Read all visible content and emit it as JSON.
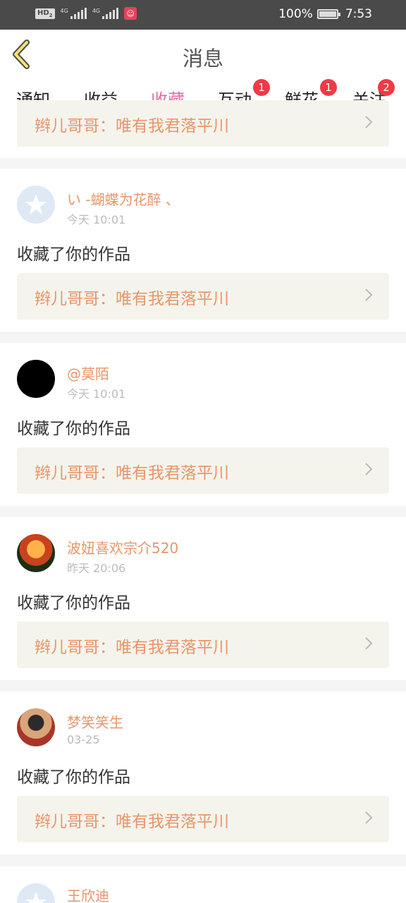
{
  "status_bar": {
    "hd": "HD",
    "hd_sub": "2",
    "net1": "4G",
    "net2": "4G",
    "battery": "100%",
    "time": "7:53"
  },
  "header": {
    "title": "消息"
  },
  "tabs": [
    {
      "label": "通知",
      "badge": ""
    },
    {
      "label": "收益",
      "badge": ""
    },
    {
      "label": "收藏",
      "badge": ""
    },
    {
      "label": "互动",
      "badge": "1"
    },
    {
      "label": "鲜花",
      "badge": "1"
    },
    {
      "label": "关注",
      "badge": "2"
    }
  ],
  "active_tab": "收藏",
  "top_partial_work": "辫儿哥哥：唯有我君落平川",
  "items": [
    {
      "name": "い -蝴蝶为花醉 、",
      "time": "今天 10:01",
      "action": "收藏了你的作品",
      "work": "辫儿哥哥：唯有我君落平川"
    },
    {
      "name": "@莫陌",
      "time": "今天 10:01",
      "action": "收藏了你的作品",
      "work": "辫儿哥哥：唯有我君落平川"
    },
    {
      "name": "波妞喜欢宗介520",
      "time": "昨天 20:06",
      "action": "收藏了你的作品",
      "work": "辫儿哥哥：唯有我君落平川"
    },
    {
      "name": "梦笑笑生",
      "time": "03-25",
      "action": "收藏了你的作品",
      "work": "辫儿哥哥：唯有我君落平川"
    },
    {
      "name": "王欣迪",
      "time": "",
      "action": "",
      "work": ""
    }
  ],
  "colors": {
    "accent": "#e36aa5",
    "name": "#e9956a",
    "badge": "#f03a46"
  }
}
